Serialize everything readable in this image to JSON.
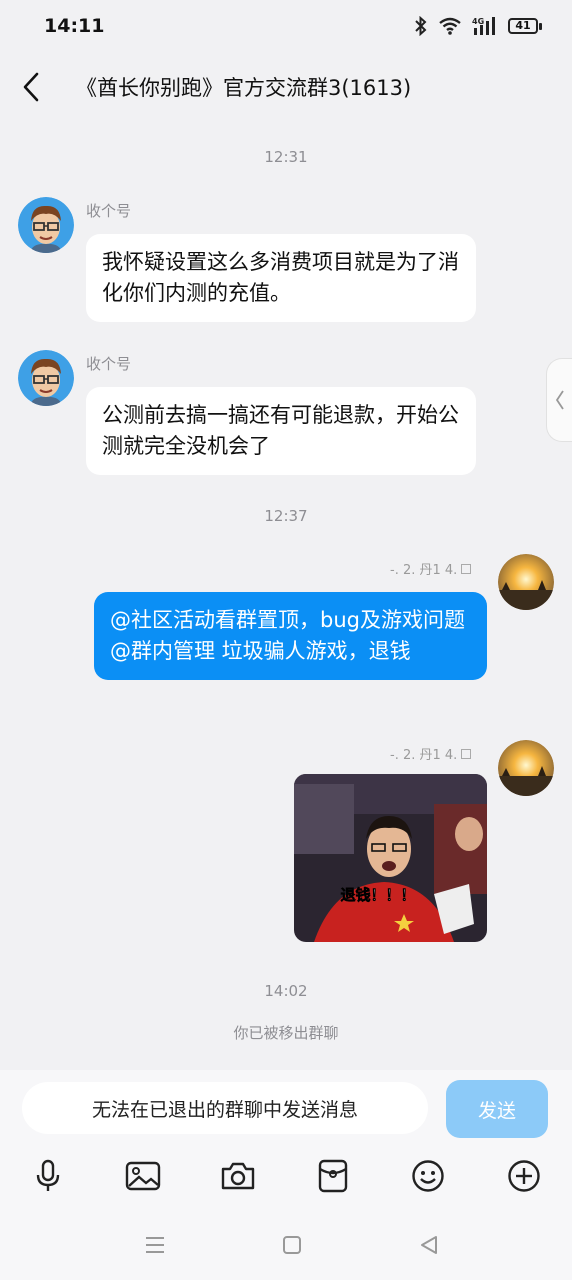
{
  "status_bar": {
    "time": "14:11",
    "battery": "41"
  },
  "header": {
    "title": "《酋长你别跑》官方交流群3(1613)"
  },
  "messages": {
    "time1": "12:31",
    "msg1": {
      "sender": "收个号",
      "text": "我怀疑设置这么多消费项目就是为了消化你们内测的充值。"
    },
    "msg2": {
      "sender": "收个号",
      "text": "公测前去搞一搞还有可能退款，开始公测就完全没机会了"
    },
    "time2": "12:37",
    "msg3": {
      "meta": "-. 2. 丹1 4.",
      "text": "@社区活动看群置顶，bug及游戏问题@群内管理 垃圾骗人游戏，退钱"
    },
    "msg4": {
      "meta": "-. 2. 丹1 4.",
      "image_caption": "退钱！！！"
    },
    "time3": "14:02",
    "system_note": "你已被移出群聊"
  },
  "input": {
    "placeholder": "无法在已退出的群聊中发送消息",
    "send_label": "发送"
  },
  "colors": {
    "outgoing_bubble": "#0b8ff5",
    "send_disabled": "#8ccaf8",
    "background": "#f1f1f3"
  },
  "icons": [
    "microphone-icon",
    "image-icon",
    "camera-icon",
    "red-packet-icon",
    "emoji-icon",
    "plus-icon"
  ]
}
